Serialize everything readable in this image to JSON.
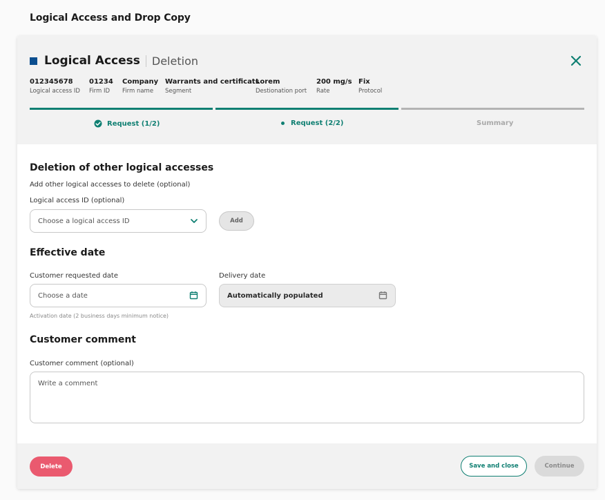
{
  "page": {
    "title": "Logical Access and Drop Copy"
  },
  "header": {
    "title": "Logical Access",
    "subtitle": "Deletion",
    "close_icon": "close-icon",
    "meta": [
      {
        "value": "012345678",
        "label": "Logical access ID"
      },
      {
        "value": "01234",
        "label": "Firm ID"
      },
      {
        "value": "Company",
        "label": "Firm name"
      },
      {
        "value": "Warrants and certificats",
        "label": "Segment"
      },
      {
        "value": "Lorem",
        "label": "Destionation port"
      },
      {
        "value": "200 mg/s",
        "label": "Rate"
      },
      {
        "value": "Fix",
        "label": "Protocol"
      }
    ]
  },
  "stepper": {
    "steps": [
      {
        "label": "Request (1/2)",
        "state": "completed",
        "icon": "check-circle-icon"
      },
      {
        "label": "Request (2/2)",
        "state": "current",
        "icon": "dot-icon"
      },
      {
        "label": "Summary",
        "state": "upcoming"
      }
    ]
  },
  "deletion": {
    "title": "Deletion of other logical accesses",
    "description": "Add other logical accesses to delete (optional)",
    "id_label": "Logical access ID (optional)",
    "id_placeholder": "Choose a logical access ID",
    "add_label": "Add"
  },
  "effective": {
    "title": "Effective date",
    "requested_label": "Customer requested date",
    "requested_placeholder": "Choose a date",
    "requested_hint": "Activation date (2 business days minimum notice)",
    "delivery_label": "Delivery date",
    "delivery_value": "Automatically populated"
  },
  "comment": {
    "title": "Customer comment",
    "label": "Customer comment (optional)",
    "placeholder": "Write a comment"
  },
  "footer": {
    "delete_label": "Delete",
    "save_close_label": "Save and close",
    "continue_label": "Continue"
  },
  "colors": {
    "accent": "#0f7f72",
    "brand_square": "#0b4e8f",
    "delete": "#ea5a6f",
    "inactive": "#b3b3b3"
  }
}
